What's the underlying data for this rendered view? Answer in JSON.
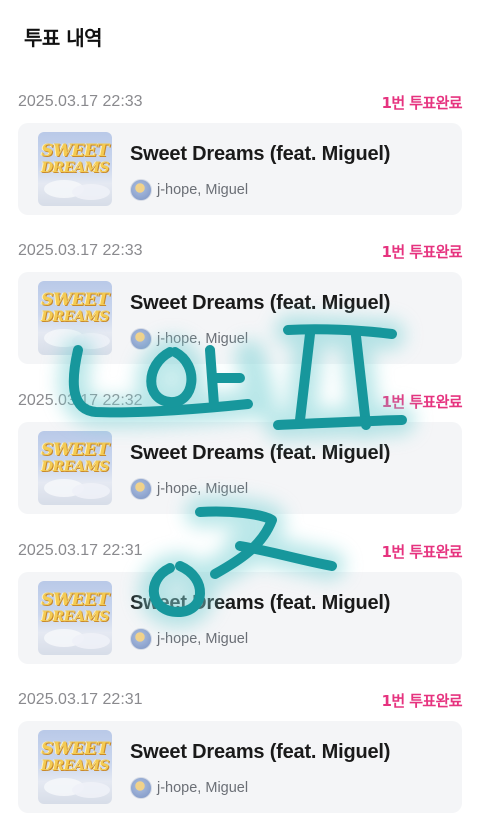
{
  "header": {
    "title": "투표 내역"
  },
  "colors": {
    "accent": "#e6337f",
    "card_bg": "#f4f5f7",
    "scribble": "#1a9aa0"
  },
  "icons": {
    "album_art": "album-art-sweet-dreams",
    "avatar": "artist-avatar"
  },
  "album_art_text": [
    "SWEET",
    "DREAMS"
  ],
  "votes": [
    {
      "date": "2025.03.17 22:33",
      "status": "1번 투표완료",
      "song": "Sweet Dreams (feat. Miguel)",
      "artist": "j-hope, Miguel"
    },
    {
      "date": "2025.03.17 22:33",
      "status": "1번 투표완료",
      "song": "Sweet Dreams (feat. Miguel)",
      "artist": "j-hope, Miguel"
    },
    {
      "date": "2025.03.17 22:32",
      "status": "1번 투표완료",
      "song": "Sweet Dreams (feat. Miguel)",
      "artist": "j-hope, Miguel"
    },
    {
      "date": "2025.03.17 22:31",
      "status": "1번 투표완료",
      "song": "Sweet Dreams (feat. Miguel)",
      "artist": "j-hope, Miguel"
    },
    {
      "date": "2025.03.17 22:31",
      "status": "1번 투표완료",
      "song": "Sweet Dreams (feat. Miguel)",
      "artist": "j-hope, Miguel"
    }
  ]
}
